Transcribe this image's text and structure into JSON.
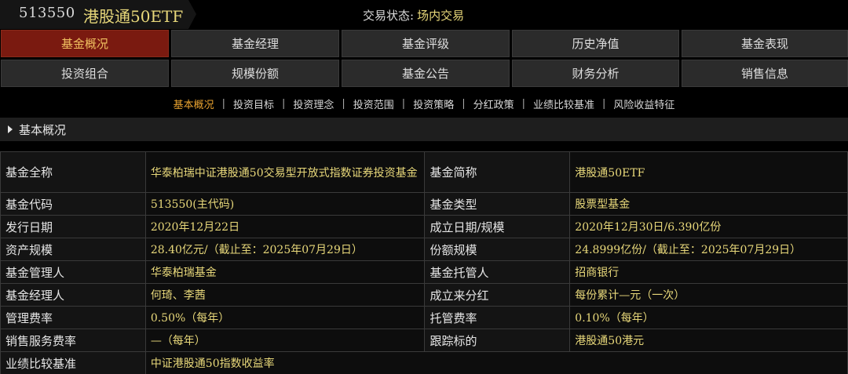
{
  "header": {
    "code": "513550",
    "name": "港股通50ETF",
    "status_label": "交易状态:",
    "status_value": "场内交易"
  },
  "tabs": [
    {
      "label": "基金概况"
    },
    {
      "label": "基金经理"
    },
    {
      "label": "基金评级"
    },
    {
      "label": "历史净值"
    },
    {
      "label": "基金表现"
    },
    {
      "label": "投资组合"
    },
    {
      "label": "规模份额"
    },
    {
      "label": "基金公告"
    },
    {
      "label": "财务分析"
    },
    {
      "label": "销售信息"
    }
  ],
  "subnav": [
    {
      "label": "基本概况"
    },
    {
      "label": "投资目标"
    },
    {
      "label": "投资理念"
    },
    {
      "label": "投资范围"
    },
    {
      "label": "投资策略"
    },
    {
      "label": "分红政策"
    },
    {
      "label": "业绩比较基准"
    },
    {
      "label": "风险收益特征"
    }
  ],
  "section_title": "基本概况",
  "rows": [
    {
      "k1": "基金全称",
      "v1": "华泰柏瑞中证港股通50交易型开放式指数证券投资基金",
      "k2": "基金简称",
      "v2": "港股通50ETF"
    },
    {
      "k1": "基金代码",
      "v1": "513550(主代码)",
      "k2": "基金类型",
      "v2": "股票型基金"
    },
    {
      "k1": "发行日期",
      "v1": "2020年12月22日",
      "k2": "成立日期/规模",
      "v2": "2020年12月30日/6.390亿份"
    },
    {
      "k1": "资产规模",
      "v1": "28.40亿元/（截止至：2025年07月29日）",
      "k2": "份额规模",
      "v2": "24.8999亿份/（截止至：2025年07月29日）"
    },
    {
      "k1": "基金管理人",
      "v1": "华泰柏瑞基金",
      "k2": "基金托管人",
      "v2": "招商银行"
    },
    {
      "k1": "基金经理人",
      "v1": "何琦、李茜",
      "k2": "成立来分红",
      "v2": "每份累计—元（一次）"
    },
    {
      "k1": "管理费率",
      "v1": "0.50%（每年）",
      "k2": "托管费率",
      "v2": "0.10%（每年）"
    },
    {
      "k1": "销售服务费率",
      "v1": "—（每年）",
      "k2": "跟踪标的",
      "v2": "港股通50港元"
    },
    {
      "k1": "业绩比较基准",
      "v1": "中证港股通50指数收益率",
      "k2": "",
      "v2": ""
    }
  ]
}
